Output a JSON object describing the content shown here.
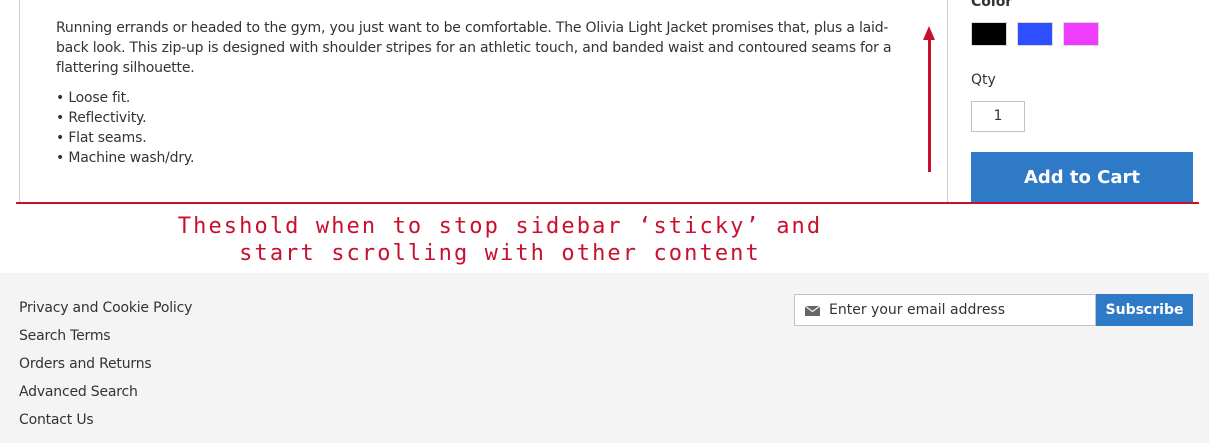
{
  "description": {
    "paragraph": "Running errands or headed to the gym, you just want to be comfortable. The Olivia Light Jacket promises that, plus a laid-back look. This zip-up is designed with shoulder stripes for an athletic touch, and banded waist and contoured seams for a flattering silhouette.",
    "bullets": [
      "Loose fit.",
      "Reflectivity.",
      "Flat seams.",
      "Machine wash/dry."
    ]
  },
  "sidebar": {
    "color_label": "Color",
    "swatches": [
      {
        "name": "black",
        "hex": "#000000"
      },
      {
        "name": "blue",
        "hex": "#2e4fff"
      },
      {
        "name": "pink",
        "hex": "#ef3dff"
      }
    ],
    "qty_label": "Qty",
    "qty_value": "1",
    "add_to_cart_label": "Add to Cart"
  },
  "annotation": {
    "line1": "Theshold when to stop sidebar ‘sticky’ and",
    "line2": "start scrolling with other content",
    "color": "#c8102e"
  },
  "footer": {
    "links": [
      "Privacy and Cookie Policy",
      "Search Terms",
      "Orders and Returns",
      "Advanced Search",
      "Contact Us"
    ],
    "newsletter": {
      "icon": "envelope-icon",
      "placeholder": "Enter your email address",
      "subscribe_label": "Subscribe"
    }
  },
  "colors": {
    "accent": "#2f7ac6",
    "footer_bg": "#f4f4f4"
  }
}
